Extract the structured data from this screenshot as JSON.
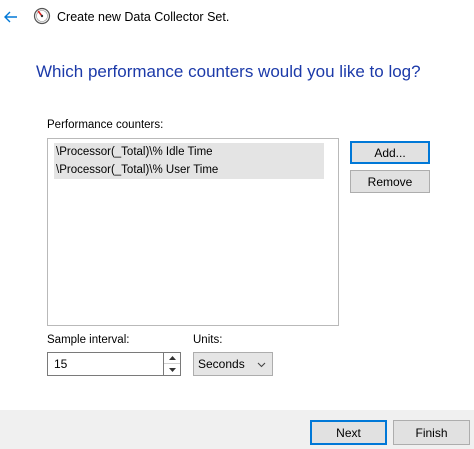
{
  "window": {
    "title": "Create new Data Collector Set."
  },
  "heading": "Which performance counters would you like to log?",
  "counters": {
    "label": "Performance counters:",
    "items": [
      "\\Processor(_Total)\\% Idle Time",
      "\\Processor(_Total)\\% User Time"
    ]
  },
  "buttons": {
    "add": "Add...",
    "remove": "Remove",
    "next": "Next",
    "finish": "Finish"
  },
  "sample_interval": {
    "label": "Sample interval:",
    "value": "15"
  },
  "units": {
    "label": "Units:",
    "value": "Seconds"
  },
  "icons": {
    "back": "back-arrow-icon",
    "app": "performance-monitor-gauge-icon",
    "spin_up": "caret-up-icon",
    "spin_down": "caret-down-icon",
    "dropdown": "chevron-down-icon"
  },
  "colors": {
    "heading": "#1c3aa9",
    "back_arrow": "#0078d7",
    "default_button_border": "#0078d7",
    "list_item_highlight": "#e4e4e4",
    "footer_background": "#f0f0f0"
  }
}
